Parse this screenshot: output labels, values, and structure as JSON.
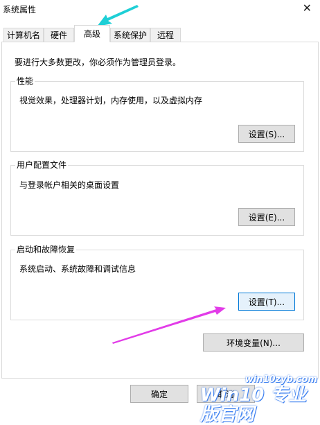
{
  "window": {
    "title": "系统属性",
    "close_glyph": "✕"
  },
  "tabs": [
    {
      "label": "计算机名",
      "active": false
    },
    {
      "label": "硬件",
      "active": false
    },
    {
      "label": "高级",
      "active": true
    },
    {
      "label": "系统保护",
      "active": false
    },
    {
      "label": "远程",
      "active": false
    }
  ],
  "advanced": {
    "intro": "要进行大多数更改，你必须作为管理员登录。",
    "performance": {
      "title": "性能",
      "description": "视觉效果，处理器计划，内存使用，以及虚拟内存",
      "button": "设置(S)..."
    },
    "user_profiles": {
      "title": "用户配置文件",
      "description": "与登录帐户相关的桌面设置",
      "button": "设置(E)..."
    },
    "startup_recovery": {
      "title": "启动和故障恢复",
      "description": "系统启动、系统故障和调试信息",
      "button": "设置(T)..."
    },
    "env_button": "环境变量(N)..."
  },
  "footer": {
    "ok": "确定",
    "cancel": "取消"
  },
  "annotations": {
    "tab_arrow_color": "#1ecfd6",
    "button_arrow_color": "#e23ce8"
  },
  "watermark": {
    "top": "win10zyb.com",
    "bottom": "Win10 专业版官网"
  }
}
